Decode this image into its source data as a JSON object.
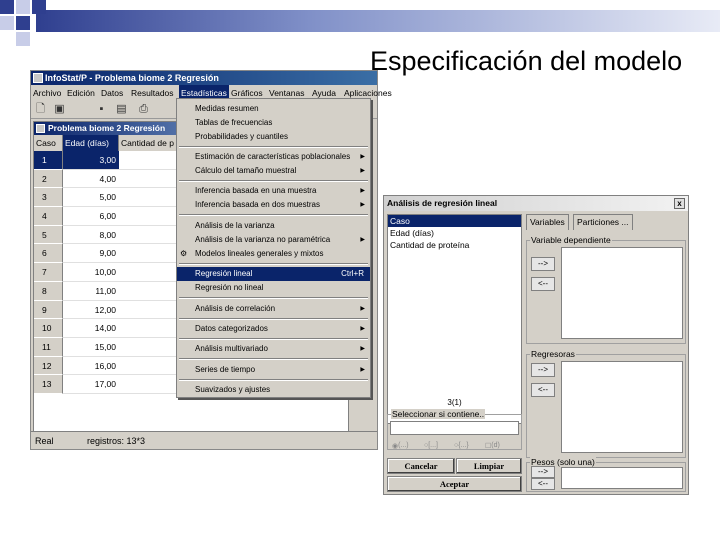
{
  "slide": {
    "title": "Especificación del modelo"
  },
  "main_window": {
    "title": "InfoStat/P - Problema biome 2 Regresión",
    "menu": [
      "Archivo",
      "Edición",
      "Datos",
      "Resultados",
      "Estadísticas",
      "Gráficos",
      "Ventanas",
      "Ayuda",
      "Aplicaciones"
    ],
    "document_title": "Problema biome 2 Regresión",
    "columns": [
      "Caso",
      "Edad (días)",
      "Cantidad de p"
    ],
    "rows": [
      {
        "caso": "1",
        "edad": "3,00"
      },
      {
        "caso": "2",
        "edad": "4,00"
      },
      {
        "caso": "3",
        "edad": "5,00"
      },
      {
        "caso": "4",
        "edad": "6,00"
      },
      {
        "caso": "5",
        "edad": "8,00"
      },
      {
        "caso": "6",
        "edad": "9,00"
      },
      {
        "caso": "7",
        "edad": "10,00"
      },
      {
        "caso": "8",
        "edad": "11,00"
      },
      {
        "caso": "9",
        "edad": "12,00"
      },
      {
        "caso": "10",
        "edad": "14,00"
      },
      {
        "caso": "11",
        "edad": "15,00"
      },
      {
        "caso": "12",
        "edad": "16,00"
      },
      {
        "caso": "13",
        "edad": "17,00"
      }
    ],
    "status": {
      "left": "Real",
      "right": "registros: 13*3"
    }
  },
  "menu_estadisticas": {
    "items": [
      {
        "label": "Medidas resumen"
      },
      {
        "label": "Tablas de frecuencias"
      },
      {
        "label": "Probabilidades y cuantiles"
      },
      {
        "label": "Estimación de características poblacionales"
      },
      {
        "label": "Cálculo del tamaño muestral"
      },
      {
        "label": "Inferencia basada en una muestra"
      },
      {
        "label": "Inferencia basada en dos muestras"
      },
      {
        "label": "Análisis de la varianza"
      },
      {
        "label": "Análisis de la varianza no paramétrica"
      },
      {
        "label": "Modelos lineales generales y mixtos"
      },
      {
        "label": "Regresión lineal",
        "shortcut": "Ctrl+R"
      },
      {
        "label": "Regresión no lineal"
      },
      {
        "label": "Análisis de correlación"
      },
      {
        "label": "Datos categorizados"
      },
      {
        "label": "Análisis multivariado"
      },
      {
        "label": "Series de tiempo"
      },
      {
        "label": "Suavizados y ajustes"
      }
    ]
  },
  "dialog": {
    "title": "Análisis de regresión lineal",
    "close": "x",
    "variables": [
      "Caso",
      "Edad (días)",
      "Cantidad de proteína"
    ],
    "tabs": [
      "Variables",
      "Particiones ..."
    ],
    "dependent_label": "Variable dependiente",
    "regressors_label": "Regresoras",
    "weights_label": "Pesos (solo una)",
    "arrow_right": "-->",
    "arrow_left": "<--",
    "count": "3(1)",
    "filter_label": "Seleccionar si contiene..",
    "radio_options": [
      "(...)",
      "[...]",
      "{...}",
      "(d)"
    ],
    "cancel": "Cancelar",
    "clear": "Limpiar",
    "accept": "Aceptar"
  }
}
